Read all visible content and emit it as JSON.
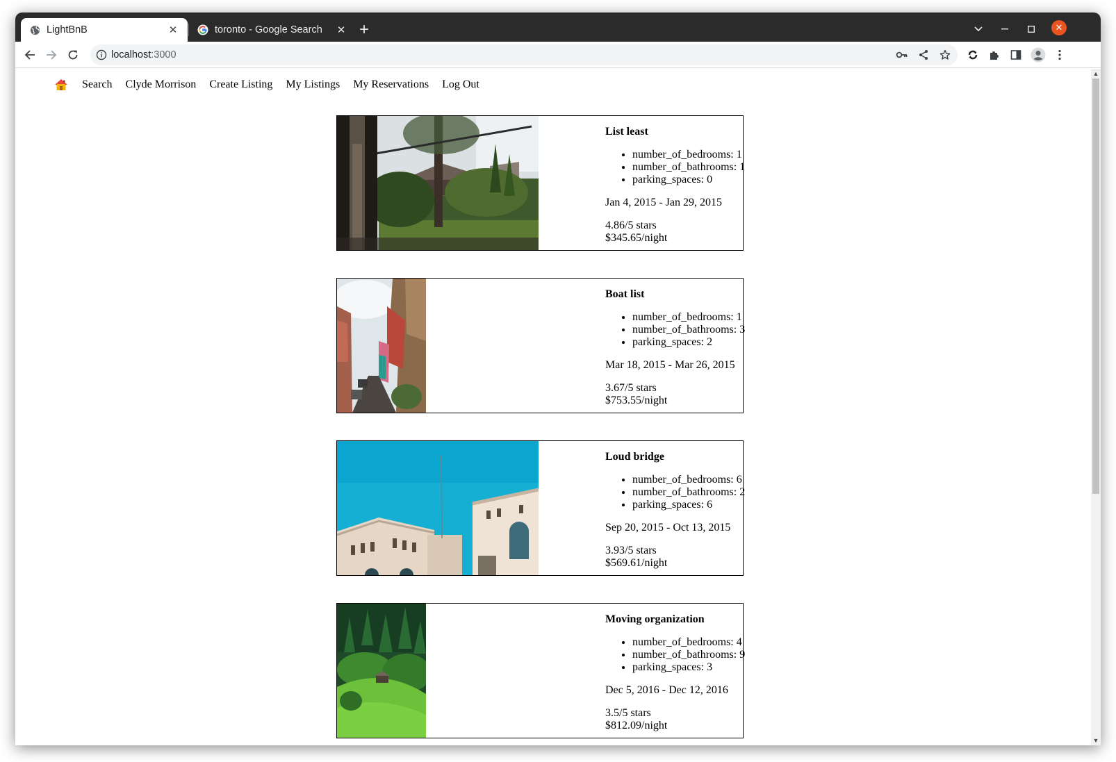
{
  "browser": {
    "tabs": [
      {
        "title": "LightBnB",
        "active": true
      },
      {
        "title": "toronto - Google Search",
        "active": false
      }
    ],
    "url_host": "localhost",
    "url_port": ":3000"
  },
  "nav": {
    "items": [
      "Search",
      "Clyde Morrison",
      "Create Listing",
      "My Listings",
      "My Reservations",
      "Log Out"
    ]
  },
  "listings": [
    {
      "title": "List least",
      "details": [
        "number_of_bedrooms: 1",
        "number_of_bathrooms: 1",
        "parking_spaces: 0"
      ],
      "dates": "Jan 4, 2015 - Jan 29, 2015",
      "rating": "4.86/5 stars",
      "price": "$345.65/night",
      "photo": "garden-house"
    },
    {
      "title": "Boat list",
      "details": [
        "number_of_bedrooms: 1",
        "number_of_bathrooms: 3",
        "parking_spaces: 2"
      ],
      "dates": "Mar 18, 2015 - Mar 26, 2015",
      "rating": "3.67/5 stars",
      "price": "$753.55/night",
      "photo": "colorful-street"
    },
    {
      "title": "Loud bridge",
      "details": [
        "number_of_bedrooms: 6",
        "number_of_bathrooms: 2",
        "parking_spaces: 6"
      ],
      "dates": "Sep 20, 2015 - Oct 13, 2015",
      "rating": "3.93/5 stars",
      "price": "$569.61/night",
      "photo": "white-building"
    },
    {
      "title": "Moving organization",
      "details": [
        "number_of_bedrooms: 4",
        "number_of_bathrooms: 9",
        "parking_spaces: 3"
      ],
      "dates": "Dec 5, 2016 - Dec 12, 2016",
      "rating": "3.5/5 stars",
      "price": "$812.09/night",
      "photo": "green-hillside"
    }
  ]
}
